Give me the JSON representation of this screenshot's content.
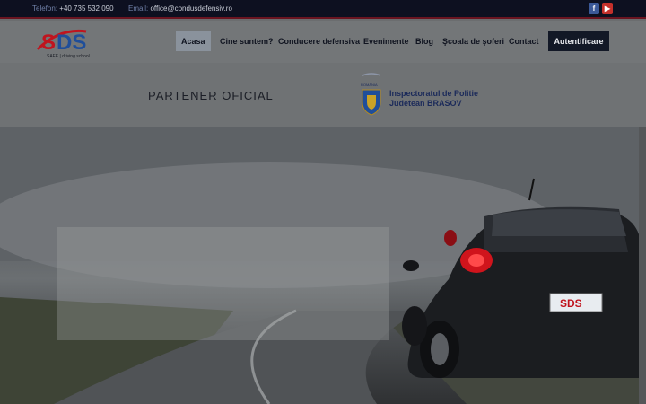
{
  "topbar": {
    "phone_label": "Telefon:",
    "phone": "+40 735 532 090",
    "email_label": "Email:",
    "email": "office@condusdefensiv.ro",
    "social": [
      {
        "icon": "facebook-icon",
        "glyph": "f"
      },
      {
        "icon": "youtube-icon",
        "glyph": "▶"
      }
    ]
  },
  "logo": {
    "mark": "SDS",
    "tagline": "SAFE | driving school"
  },
  "nav": {
    "items": [
      "Acasa",
      "Cine suntem?",
      "Conducere defensiva",
      "Evenimente",
      "Blog",
      "Şcoala de şoferi",
      "Contact"
    ],
    "active": "Acasa",
    "auth_label": "Autentificare"
  },
  "partner": {
    "label": "PARTENER OFICIAL",
    "crest_caption": "ROMÂNIA",
    "org_line1": "Inspectoratul de Politie",
    "org_line2": "Judetean BRASOV"
  },
  "hero": {
    "plate_text": "SDS"
  },
  "colors": {
    "topbar_bg": "#0d1020",
    "accent_red": "#c0141e",
    "brand_blue": "#1f4e9a",
    "button_dark": "#121826"
  }
}
